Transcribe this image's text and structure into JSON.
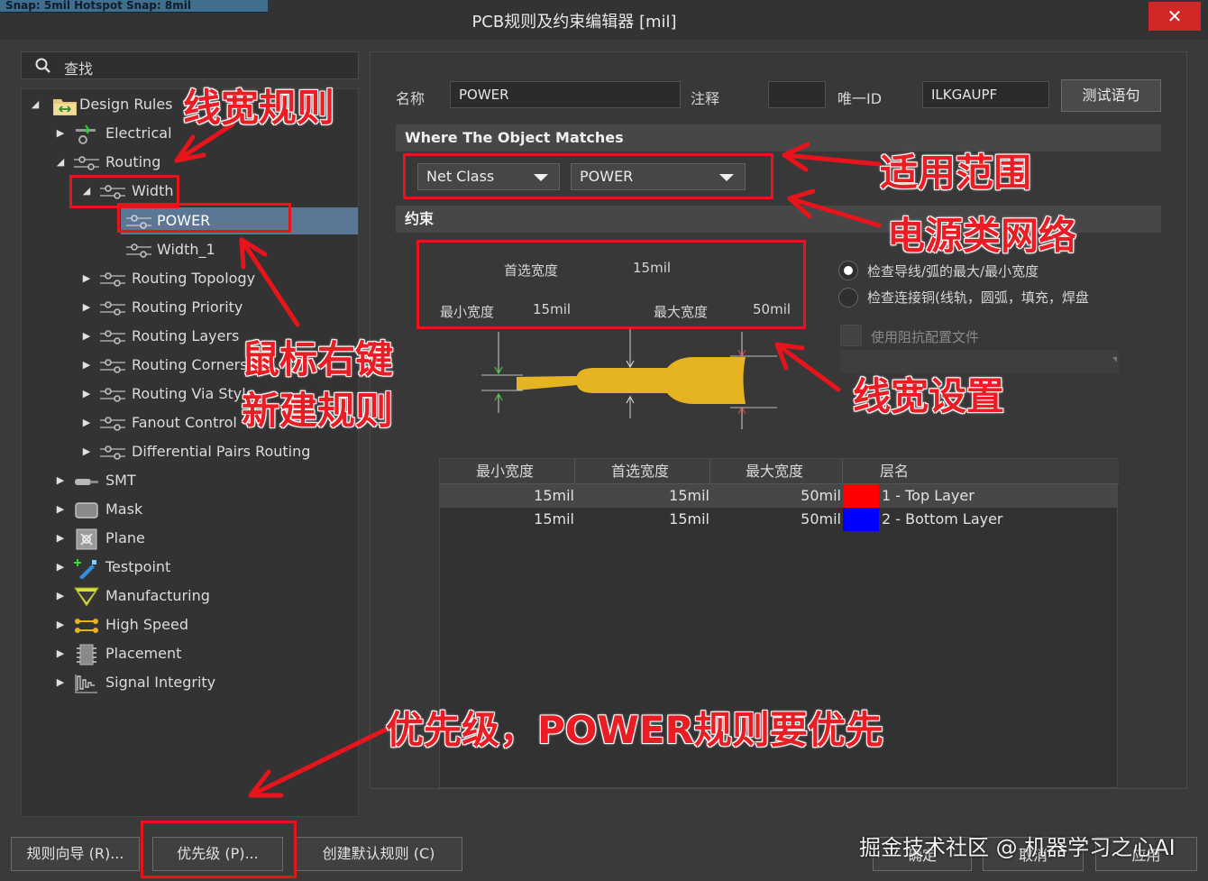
{
  "window": {
    "title": "PCB规则及约束编辑器 [mil]",
    "snap_banner": "Snap: 5mil Hotspot Snap: 8mil",
    "close_glyph": "✕"
  },
  "search": {
    "placeholder": "查找"
  },
  "tree": {
    "root": "Design Rules",
    "electrical": "Electrical",
    "routing": "Routing",
    "width": "Width",
    "power": "POWER",
    "width_1": "Width_1",
    "routing_topology": "Routing Topology",
    "routing_priority": "Routing Priority",
    "routing_layers": "Routing Layers",
    "routing_corners": "Routing Corners",
    "routing_via_style": "Routing Via Style",
    "fanout_control": "Fanout Control",
    "diff_pairs": "Differential Pairs Routing",
    "smt": "SMT",
    "mask": "Mask",
    "plane": "Plane",
    "testpoint": "Testpoint",
    "manufacturing": "Manufacturing",
    "high_speed": "High Speed",
    "placement": "Placement",
    "signal_integrity": "Signal Integrity"
  },
  "rule": {
    "name_label": "名称",
    "name_value": "POWER",
    "comment_label": "注释",
    "comment_value": "",
    "uid_label": "唯一ID",
    "uid_value": "ILKGAUPF",
    "test_button": "测试语句"
  },
  "match": {
    "header": "Where The Object Matches",
    "type": "Net Class",
    "value": "POWER"
  },
  "constraints": {
    "header": "约束",
    "preferred_label": "首选宽度",
    "preferred_value": "15mil",
    "min_label": "最小宽度",
    "min_value": "15mil",
    "max_label": "最大宽度",
    "max_value": "50mil",
    "radio1": "检查导线/弧的最大/最小宽度",
    "radio2": "检查连接铜(线轨，圆弧，填充，焊盘",
    "impedance_checkbox": "使用阻抗配置文件",
    "trace_color": "#e6b422"
  },
  "layer_table": {
    "headers": [
      "最小宽度",
      "首选宽度",
      "最大宽度",
      "层名"
    ],
    "rows": [
      {
        "min": "15mil",
        "pref": "15mil",
        "max": "50mil",
        "color": "#ff0000",
        "layer": "1 - Top Layer"
      },
      {
        "min": "15mil",
        "pref": "15mil",
        "max": "50mil",
        "color": "#0000ff",
        "layer": "2 - Bottom Layer"
      }
    ]
  },
  "buttons": {
    "wizard": "规则向导 (R)...",
    "priority": "优先级 (P)...",
    "defaults": "创建默认规则 (C)",
    "ok": "确定",
    "cancel": "取消",
    "apply": "应用"
  },
  "annotations": {
    "width_rule": "线宽规则",
    "scope": "适用范围",
    "power_net": "电源类网络",
    "right_click": "鼠标右键",
    "new_rule": "新建规则",
    "width_setting": "线宽设置",
    "priority_note": "优先级，POWER规则要优先"
  },
  "watermark": "掘金技术社区 @ 机器学习之心AI"
}
